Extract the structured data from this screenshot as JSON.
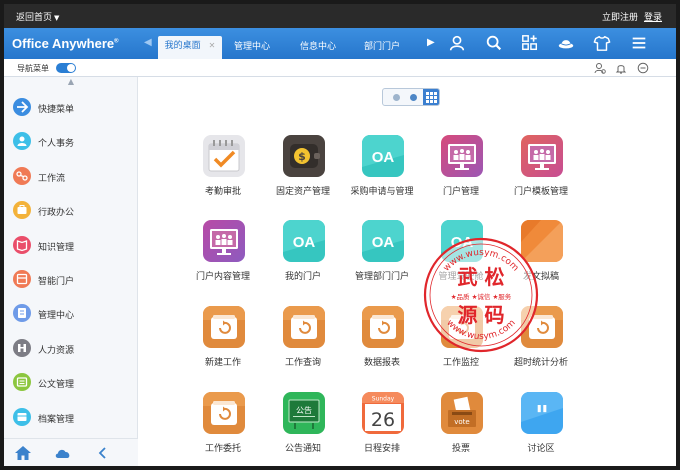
{
  "topbar": {
    "back_label": "返回首页",
    "register": "立即注册",
    "login": "登录"
  },
  "header": {
    "brand": "Office Anywhere",
    "brand_mark": "®",
    "tabs": [
      {
        "label": "我的桌面",
        "active": true
      },
      {
        "label": "管理中心"
      },
      {
        "label": "信息中心"
      },
      {
        "label": "部门门户"
      }
    ],
    "icons": [
      "user-icon",
      "search-icon",
      "apps-add-icon",
      "hat-icon",
      "shirt-icon",
      "menu-icon"
    ]
  },
  "subbar": {
    "nav_menu_label": "导航菜单",
    "icons": [
      "org-icon",
      "bell-icon",
      "chat-icon"
    ]
  },
  "sidebar": {
    "items": [
      {
        "label": "快捷菜单",
        "color": "#3b8de0"
      },
      {
        "label": "个人事务",
        "color": "#3dbfe8"
      },
      {
        "label": "工作流",
        "color": "#f07a55"
      },
      {
        "label": "行政办公",
        "color": "#f3b23a"
      },
      {
        "label": "知识管理",
        "color": "#ea4e6a"
      },
      {
        "label": "智能门户",
        "color": "#f07a55"
      },
      {
        "label": "管理中心",
        "color": "#6f9be8"
      },
      {
        "label": "人力资源",
        "color": "#7d7d85"
      },
      {
        "label": "公文管理",
        "color": "#8cc63f"
      },
      {
        "label": "档案管理",
        "color": "#3dbfe8"
      }
    ]
  },
  "apps": [
    {
      "label": "考勤审批",
      "icon": "calendar-check-icon"
    },
    {
      "label": "固定资产管理",
      "icon": "wallet-icon"
    },
    {
      "label": "采购申请与管理",
      "icon": "oa-icon"
    },
    {
      "label": "门户管理",
      "icon": "portal-icon"
    },
    {
      "label": "门户模板管理",
      "icon": "portal-template-icon"
    },
    {
      "label": "门户内容管理",
      "icon": "portal-content-icon"
    },
    {
      "label": "我的门户",
      "icon": "oa-icon"
    },
    {
      "label": "管理部门门户",
      "icon": "oa-icon"
    },
    {
      "label": "管理驾驶舱",
      "icon": "oa-icon"
    },
    {
      "label": "发文拟稿",
      "icon": "draft-icon"
    },
    {
      "label": "新建工作",
      "icon": "work-icon"
    },
    {
      "label": "工作查询",
      "icon": "work-icon"
    },
    {
      "label": "数据报表",
      "icon": "work-icon"
    },
    {
      "label": "工作监控",
      "icon": "work-icon"
    },
    {
      "label": "超时统计分析",
      "icon": "work-icon"
    },
    {
      "label": "工作委托",
      "icon": "work-icon"
    },
    {
      "label": "公告通知",
      "icon": "notice-board-icon"
    },
    {
      "label": "日程安排",
      "icon": "calendar-icon"
    },
    {
      "label": "投票",
      "icon": "vote-icon"
    },
    {
      "label": "讨论区",
      "icon": "discussion-icon"
    }
  ],
  "tile_text": {
    "oa": "OA",
    "notice": "公告",
    "cal_weekday": "Sunday",
    "cal_day": "26",
    "vote": "vote"
  },
  "watermark": {
    "title_line1": "武 松",
    "title_line2": "源 码",
    "slogan": "★品质 ★诚信 ★服务",
    "url_top": "www.wusym.com",
    "url_bottom": "www.wusym.com"
  }
}
